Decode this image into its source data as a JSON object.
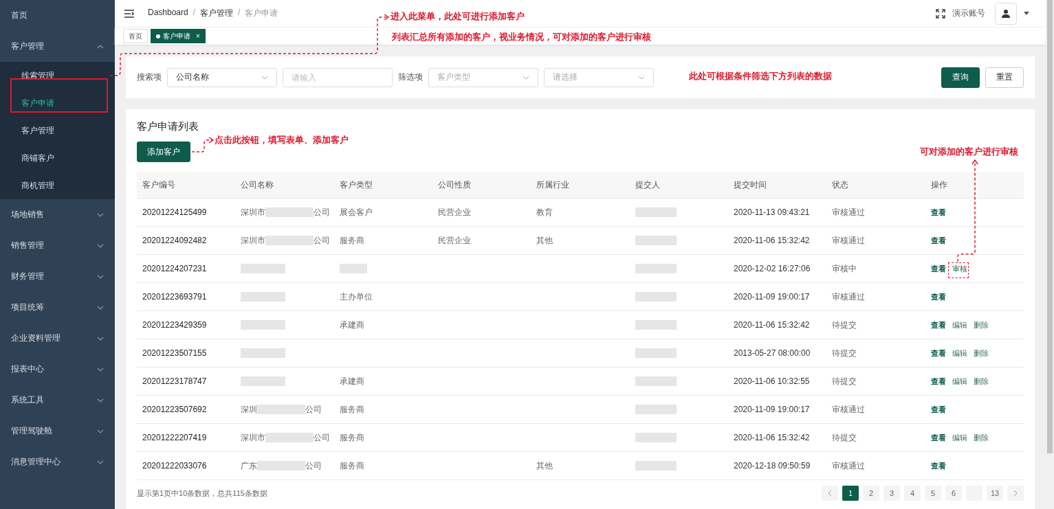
{
  "sidebar": {
    "items": [
      {
        "label": "首页"
      },
      {
        "label": "客户管理",
        "expanded": true,
        "children": [
          {
            "label": "线索管理",
            "selected": false
          },
          {
            "label": "客户申请",
            "selected": true
          },
          {
            "label": "客户管理",
            "selected": false
          },
          {
            "label": "商铺客户",
            "selected": false
          },
          {
            "label": "商机管理",
            "selected": false
          }
        ]
      },
      {
        "label": "场地销售",
        "expanded": false
      },
      {
        "label": "销售管理",
        "expanded": false
      },
      {
        "label": "财务管理",
        "expanded": false
      },
      {
        "label": "项目统筹",
        "expanded": false
      },
      {
        "label": "企业资料管理",
        "expanded": false
      },
      {
        "label": "报表中心",
        "expanded": false
      },
      {
        "label": "系统工具",
        "expanded": false
      },
      {
        "label": "管理驾驶舱",
        "expanded": false
      },
      {
        "label": "消息管理中心",
        "expanded": false
      }
    ]
  },
  "breadcrumb": {
    "separator": "/",
    "items": [
      "Dashboard",
      "客户管理",
      "客户申请"
    ]
  },
  "account": {
    "name": "演示账号"
  },
  "tags": [
    {
      "label": "首页",
      "selected": false
    },
    {
      "label": "客户申请",
      "selected": true,
      "close": "×"
    }
  ],
  "filter": {
    "search_label": "搜索项",
    "search_field": {
      "value": "公司名称"
    },
    "search_input": {
      "placeholder": "请输入"
    },
    "filter_label": "筛选项",
    "filter_type": {
      "placeholder": "客户类型"
    },
    "filter_value": {
      "placeholder": "请选择"
    },
    "buttons": [
      {
        "label": "查询",
        "kind": "primary"
      },
      {
        "label": "重置",
        "kind": "default"
      }
    ]
  },
  "list": {
    "title": "客户申请列表",
    "add_button": "添加客户",
    "columns": [
      "客户编号",
      "公司名称",
      "客户类型",
      "公司性质",
      "所属行业",
      "提交人",
      "提交时间",
      "状态",
      "操作"
    ],
    "rows": [
      {
        "id": "20201224125499",
        "company": {
          "prefix": "深圳市",
          "suffix": "公司"
        },
        "type": "展会客户",
        "nature": "民营企业",
        "industry": "教育",
        "time": "2020-11-13 09:43:21",
        "status": "审核通过",
        "actions": [
          {
            "label": "查看",
            "kind": "view"
          }
        ]
      },
      {
        "id": "20201224092482",
        "company": {
          "prefix": "深圳市",
          "suffix": "公司"
        },
        "type": "服务商",
        "nature": "民营企业",
        "industry": "其他",
        "time": "2020-11-06 15:32:42",
        "status": "审核通过",
        "actions": [
          {
            "label": "查看",
            "kind": "view"
          }
        ]
      },
      {
        "id": "20201224207231",
        "type_redacted": true,
        "time": "2020-12-02 16:27:06",
        "status": "审核中",
        "actions": [
          {
            "label": "查看",
            "kind": "view"
          },
          {
            "label": "审核",
            "kind": "audit"
          }
        ]
      },
      {
        "id": "20201223693791",
        "type": "主办单位",
        "time": "2020-11-09 19:00:17",
        "status": "审核通过",
        "actions": [
          {
            "label": "查看",
            "kind": "view"
          }
        ]
      },
      {
        "id": "20201223429359",
        "type": "承建商",
        "time": "2020-11-06 15:32:42",
        "status": "待提交",
        "actions": [
          {
            "label": "查看",
            "kind": "view"
          },
          {
            "label": "编辑",
            "kind": "edit"
          },
          {
            "label": "删除",
            "kind": "delete"
          }
        ]
      },
      {
        "id": "20201223507155",
        "time": "2013-05-27 08:00:00",
        "status": "待提交",
        "actions": [
          {
            "label": "查看",
            "kind": "view"
          },
          {
            "label": "编辑",
            "kind": "edit"
          },
          {
            "label": "删除",
            "kind": "delete"
          }
        ]
      },
      {
        "id": "20201223178747",
        "type": "承建商",
        "time": "2020-11-06 10:32:55",
        "status": "待提交",
        "actions": [
          {
            "label": "查看",
            "kind": "view"
          },
          {
            "label": "编辑",
            "kind": "edit"
          },
          {
            "label": "删除",
            "kind": "delete"
          }
        ]
      },
      {
        "id": "20201223507692",
        "company": {
          "prefix": "深圳",
          "suffix": "公司"
        },
        "type": "服务商",
        "time": "2020-11-09 19:00:17",
        "status": "审核通过",
        "actions": [
          {
            "label": "查看",
            "kind": "view"
          }
        ]
      },
      {
        "id": "20201222207419",
        "company": {
          "prefix": "深圳市",
          "suffix": "公司"
        },
        "type": "服务商",
        "time": "2020-11-06 15:32:42",
        "status": "待提交",
        "actions": [
          {
            "label": "查看",
            "kind": "view"
          },
          {
            "label": "编辑",
            "kind": "edit"
          },
          {
            "label": "删除",
            "kind": "delete"
          }
        ]
      },
      {
        "id": "20201222033076",
        "company": {
          "prefix": "广东",
          "suffix": "公司"
        },
        "type": "服务商",
        "industry": "其他",
        "time": "2020-12-18 09:50:59",
        "status": "审核通过",
        "actions": [
          {
            "label": "查看",
            "kind": "view"
          }
        ]
      }
    ],
    "summary": "显示第1页中10条数据，总共115条数据",
    "pages": [
      {
        "label": "1",
        "selected": true
      },
      {
        "label": "2",
        "selected": false
      },
      {
        "label": "3",
        "selected": false
      },
      {
        "label": "4",
        "selected": false
      },
      {
        "label": "5",
        "selected": false
      },
      {
        "label": "6",
        "selected": false
      },
      {
        "label": "13",
        "selected": false
      }
    ]
  },
  "annotations": [
    {
      "kind": "menu",
      "text": "进入此菜单，此处可进行添加客户"
    },
    {
      "kind": "note",
      "text": "列表汇总所有添加的客户，视业务情况，可对添加的客户进行审核"
    },
    {
      "kind": "filter",
      "text": "此处可根据条件筛选下方列表的数据"
    },
    {
      "kind": "add",
      "text": "点击此按钮，填写表单、添加客户"
    },
    {
      "kind": "audit",
      "text": "可对添加的客户进行审核"
    }
  ]
}
